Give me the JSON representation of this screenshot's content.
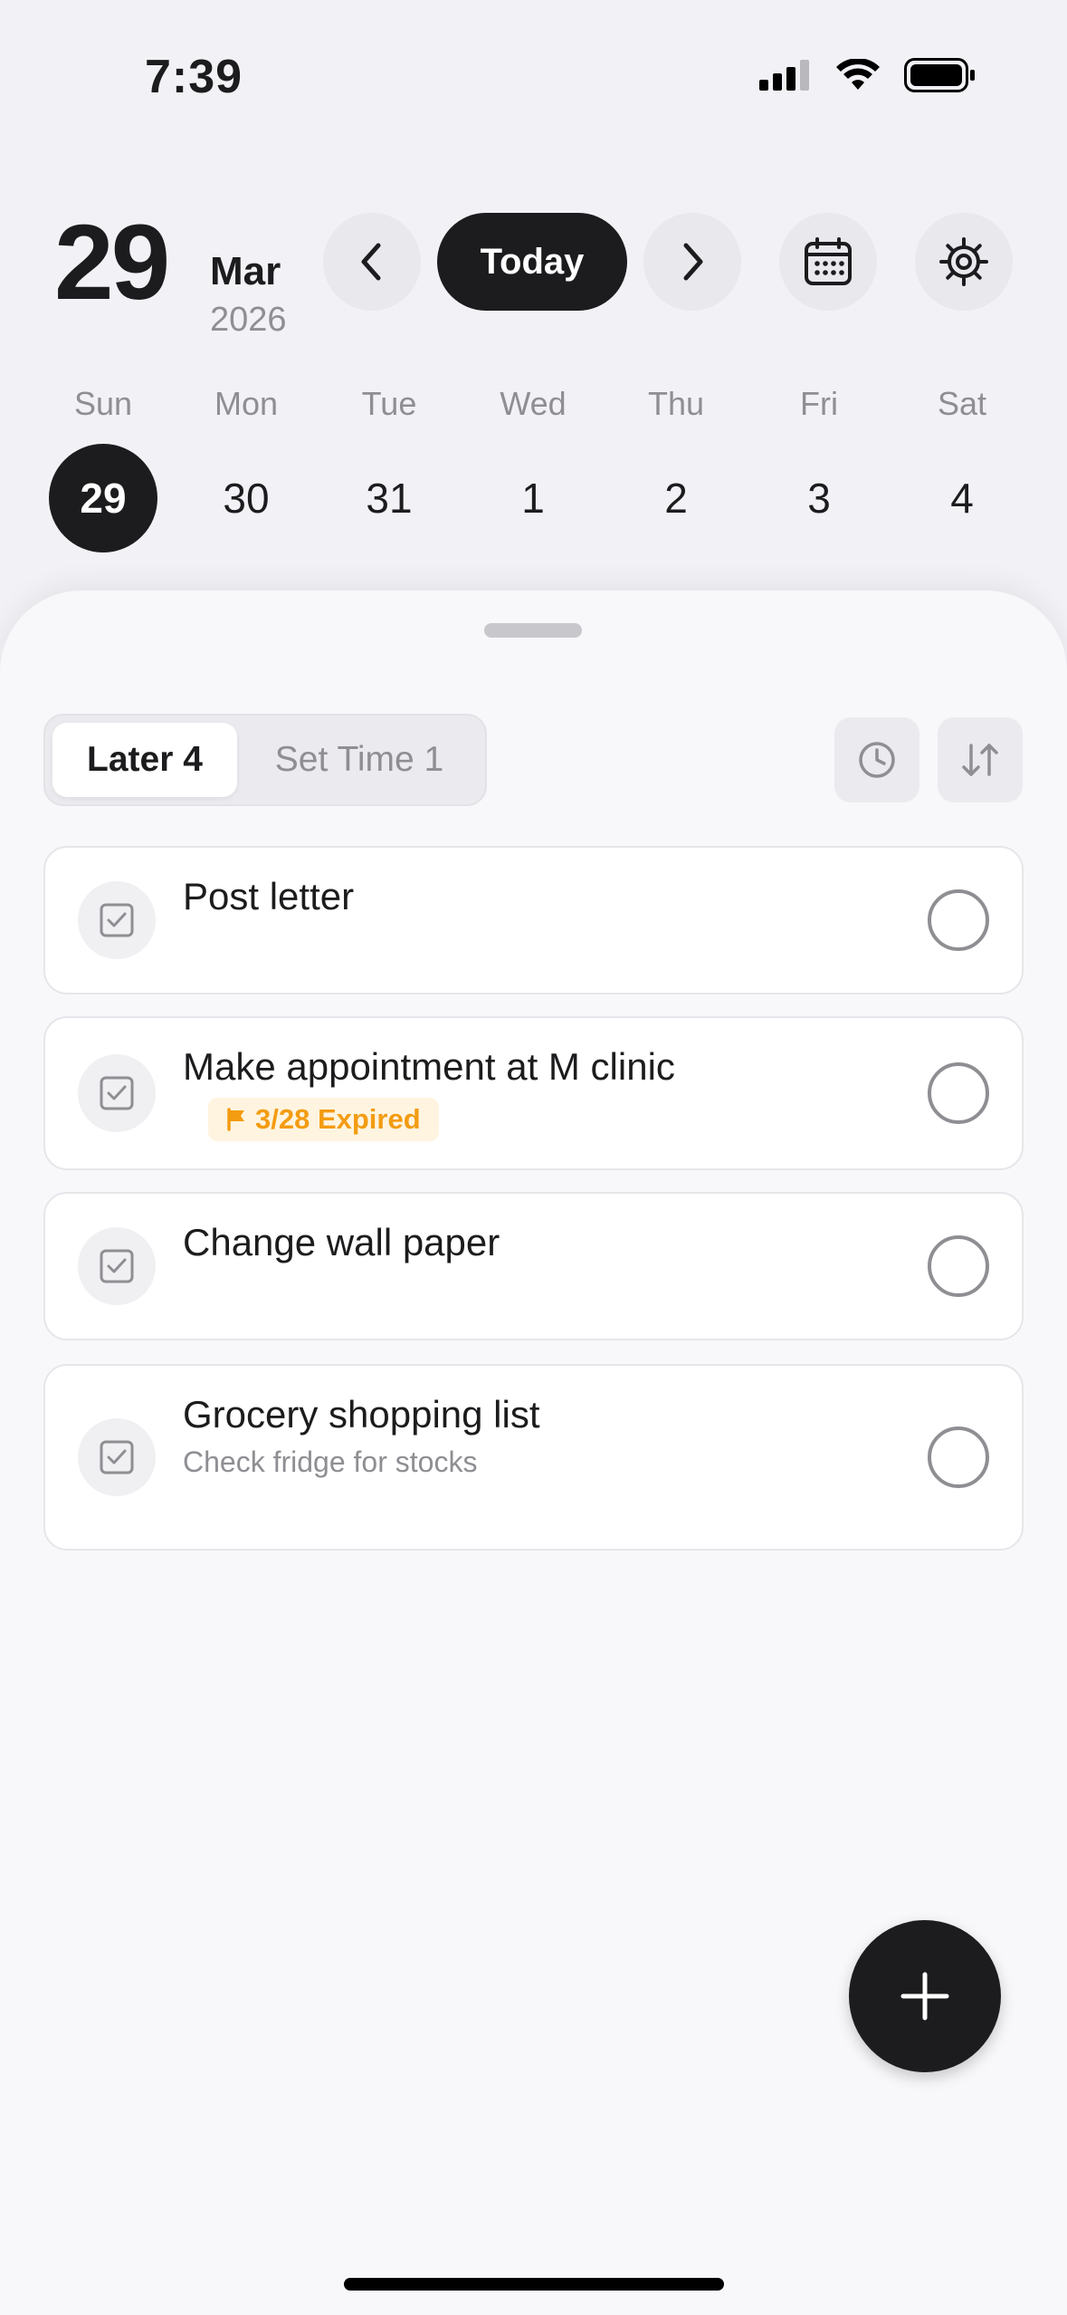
{
  "status_bar": {
    "time": "7:39"
  },
  "header": {
    "day": "29",
    "month": "Mar",
    "year": "2026",
    "today_label": "Today"
  },
  "week": {
    "labels": [
      "Sun",
      "Mon",
      "Tue",
      "Wed",
      "Thu",
      "Fri",
      "Sat"
    ],
    "dates": [
      "29",
      "30",
      "31",
      "1",
      "2",
      "3",
      "4"
    ],
    "selected_index": 0
  },
  "tabs": [
    {
      "label": "Later 4",
      "active": true
    },
    {
      "label": "Set Time 1",
      "active": false
    }
  ],
  "tasks": [
    {
      "title": "Post letter"
    },
    {
      "title": "Make appointment at M clinic",
      "badge": "3/28 Expired"
    },
    {
      "title": "Change wall paper"
    },
    {
      "title": "Grocery shopping list",
      "subtitle": "Check fridge for stocks"
    }
  ],
  "colors": {
    "accent_dark": "#1c1c1e",
    "expired_badge_text": "#f39c12",
    "expired_badge_bg": "#fff4e0",
    "muted": "#8e8e93"
  },
  "icons": [
    "signal-icon",
    "wifi-icon",
    "battery-icon",
    "chevron-left-icon",
    "chevron-right-icon",
    "calendar-icon",
    "gear-icon",
    "clock-icon",
    "sort-icon",
    "checkbox-icon",
    "flag-icon",
    "plus-icon"
  ]
}
